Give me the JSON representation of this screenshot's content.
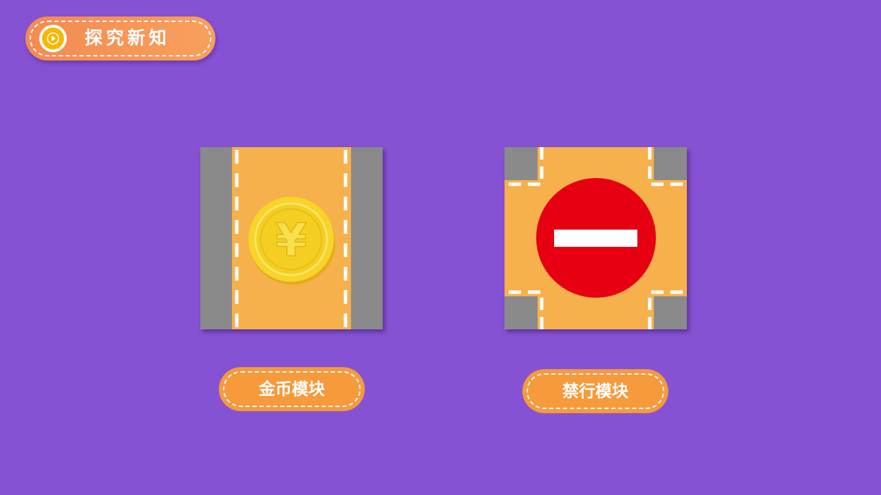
{
  "header": {
    "title": "探究新知",
    "icon": "play-icon"
  },
  "tiles": [
    {
      "name": "coin-tile",
      "icon": "yen-coin-icon",
      "symbol": "¥",
      "label": "金币模块"
    },
    {
      "name": "no-entry-tile",
      "icon": "no-entry-icon",
      "label": "禁行模块"
    }
  ],
  "colors": {
    "background": "#8652d4",
    "pill_orange": "#f69a3c",
    "road_orange": "#f6b04c",
    "road_gray": "#8a8a8a",
    "coin_gold": "#f6d428",
    "no_entry_red": "#e60012"
  }
}
